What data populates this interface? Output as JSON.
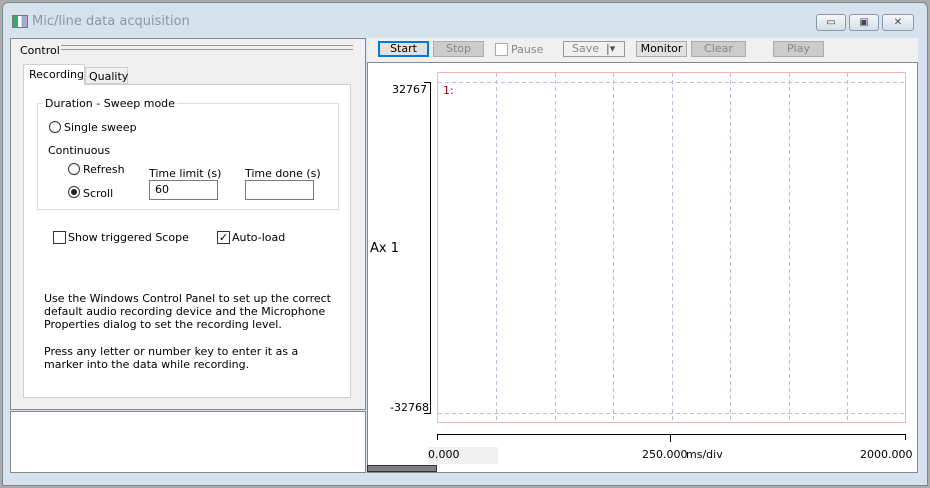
{
  "window": {
    "title": "Mic/line data acquisition",
    "minimize": "▭",
    "maximize": "▣",
    "close": "✕"
  },
  "control": {
    "title": "Control",
    "tabs": [
      {
        "label": "Recording",
        "active": true
      },
      {
        "label": "Quality",
        "active": false
      }
    ],
    "group_title": "Duration - Sweep mode",
    "single_sweep": "Single sweep",
    "continuous": "Continuous",
    "refresh": "Refresh",
    "scroll": "Scroll",
    "selected_mode": "Scroll",
    "time_limit_label": "Time limit (s)",
    "time_limit_value": "60",
    "time_done_label": "Time done (s)",
    "time_done_value": "",
    "show_triggered_scope": "Show triggered Scope",
    "show_triggered_scope_checked": false,
    "auto_load": "Auto-load",
    "auto_load_checked": true,
    "help1": "Use the Windows Control Panel to set up the correct default audio recording device and the Microphone Properties dialog to set the recording level.",
    "help2": "Press any letter or number key to enter it as a marker into the data while recording."
  },
  "toolbar": {
    "start": "Start",
    "stop": "Stop",
    "pause": "Pause",
    "save": "Save",
    "monitor": "Monitor",
    "clear": "Clear",
    "play": "Play"
  },
  "plot": {
    "channel_label": "1:",
    "axis_label": "Ax 1",
    "y_max": "32767",
    "y_min": "-32768",
    "x_start": "0.000",
    "x_mid": "250.000",
    "x_unit": "ms/div",
    "x_end": "2000.000",
    "divisions": 8
  }
}
